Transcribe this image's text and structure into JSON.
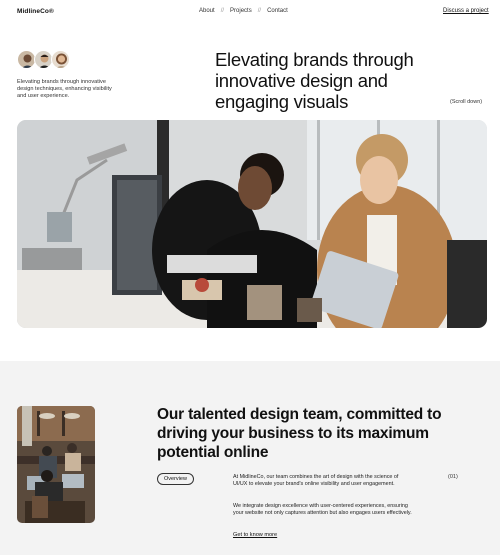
{
  "header": {
    "logo": "MidlineCo®",
    "nav": [
      "About",
      "Projects",
      "Contact"
    ],
    "separator": "//",
    "cta": "Discuss a project"
  },
  "hero": {
    "description": "Elevating brands through innovative design techniques, enhancing visibility and user experience.",
    "title": "Elevating brands through innovative design and engaging visuals",
    "scroll": "(Scroll down)"
  },
  "section2": {
    "title": "Our talented design team, committed to driving your business to its maximum potential online",
    "tag": "Overview",
    "paragraph1": "At MidlineCo, our team combines the art of design with the science of UI/UX to elevate your brand's online visibility and user engagement.",
    "paragraph2": "We integrate design excellence with user-centered experiences, ensuring your website not only captures attention but also engages users effectively.",
    "link": "Get to know more",
    "index": "(01)"
  }
}
